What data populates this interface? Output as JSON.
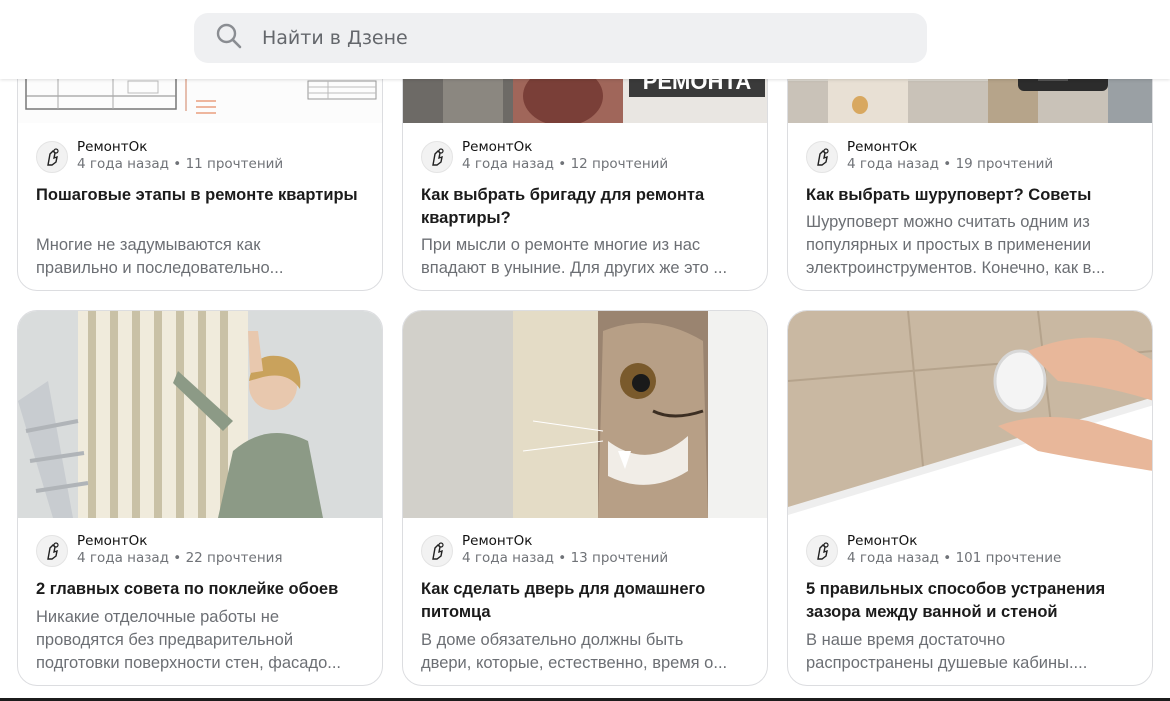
{
  "search": {
    "placeholder": "Найти в Дзене"
  },
  "cards": [
    {
      "channel": "РемонтОк",
      "age": "4 года назад",
      "reads": "11 прочтений",
      "title": "Пошаговые этапы в ремонте квартиры",
      "snippet1": "Многие не задумываются как",
      "snippet2": "правильно и последовательно..."
    },
    {
      "channel": "РемонтОк",
      "age": "4 года назад",
      "reads": "12 прочтений",
      "title": "Как выбрать бригаду для ремонта квартиры?",
      "snippet1": "При мысли о ремонте многие из нас",
      "snippet2": "впадают в уныние. Для других же это ...",
      "image_text": "РЕМОНТА"
    },
    {
      "channel": "РемонтОк",
      "age": "4 года назад",
      "reads": "19 прочтений",
      "title": "Как выбрать шуруповерт? Советы",
      "snippet1": "Шуруповерт можно считать одним из",
      "snippet2": "популярных и простых в применении",
      "snippet3": "электроинструментов. Конечно, как в..."
    },
    {
      "channel": "РемонтОк",
      "age": "4 года назад",
      "reads": "22 прочтения",
      "title": "2 главных совета по поклейке обоев",
      "snippet1": "Никакие отделочные работы не",
      "snippet2": "проводятся без предварительной",
      "snippet3": "подготовки поверхности стен, фасадо..."
    },
    {
      "channel": "РемонтОк",
      "age": "4 года назад",
      "reads": "13 прочтений",
      "title": "Как сделать дверь для домашнего питомца",
      "snippet1": "В доме обязательно должны быть",
      "snippet2": "двери, которые, естественно, время о..."
    },
    {
      "channel": "РемонтОк",
      "age": "4 года назад",
      "reads": "101 прочтение",
      "title": "5 правильных способов устранения зазора между ванной и стеной",
      "snippet1": "В наше время достаточно",
      "snippet2": "распространены душевые кабины...."
    }
  ],
  "colors": {
    "search_bg": "#eff0f2",
    "card_border": "#dcdde0",
    "muted": "#6c6f74"
  }
}
